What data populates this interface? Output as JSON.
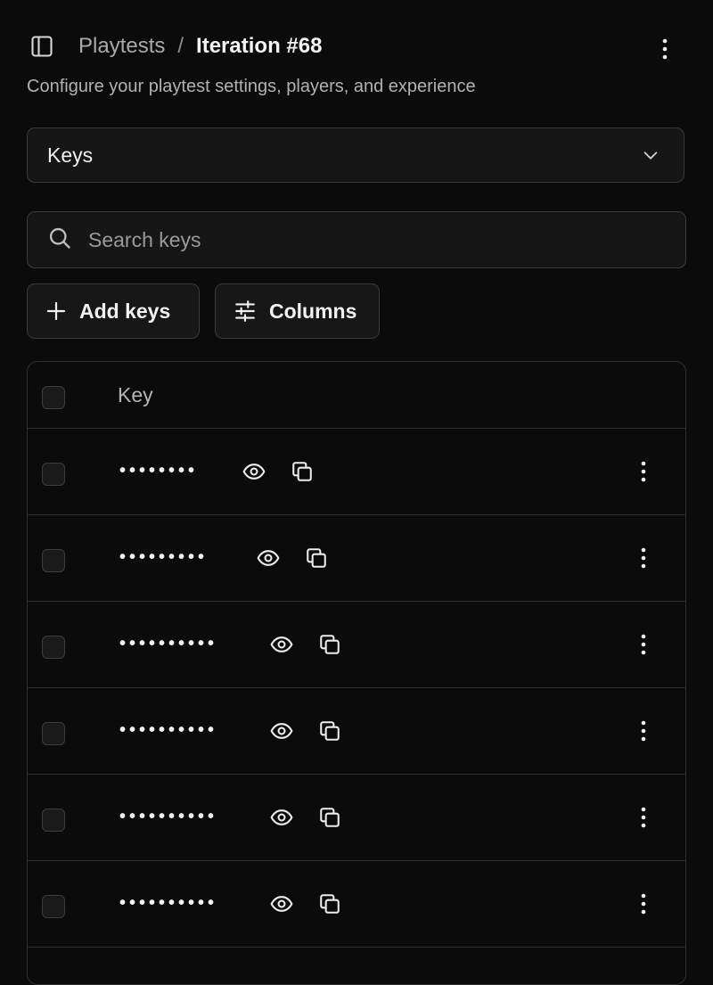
{
  "header": {
    "breadcrumb_parent": "Playtests",
    "breadcrumb_separator": "/",
    "breadcrumb_current": "Iteration #68",
    "subtitle": "Configure your playtest settings, players, and experience"
  },
  "section_select": {
    "value": "Keys"
  },
  "search": {
    "placeholder": "Search keys"
  },
  "toolbar": {
    "add_label": "Add keys",
    "columns_label": "Columns"
  },
  "table": {
    "column_header": "Key",
    "rows": [
      {
        "masked_key": "••••••••"
      },
      {
        "masked_key": "•••••••••"
      },
      {
        "masked_key": "••••••••••"
      },
      {
        "masked_key": "••••••••••"
      },
      {
        "masked_key": "••••••••••"
      },
      {
        "masked_key": "••••••••••"
      }
    ]
  },
  "icons": {
    "sidebar_toggle": "sidebar-icon",
    "more": "more-vertical-icon",
    "chevron": "chevron-down-icon",
    "search": "search-icon",
    "add": "plus-icon",
    "columns": "sliders-icon",
    "reveal": "eye-icon",
    "copy": "copy-icon"
  }
}
